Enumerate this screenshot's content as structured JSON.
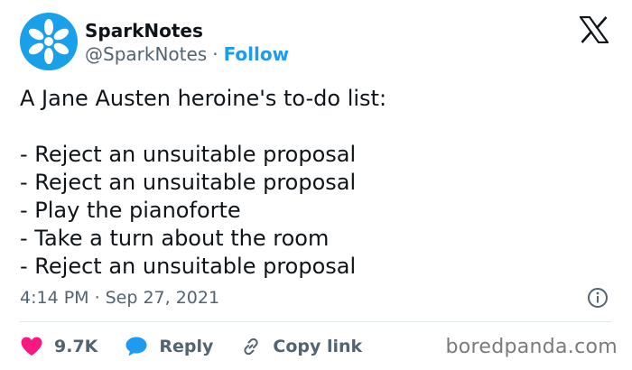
{
  "account": {
    "name": "SparkNotes",
    "handle": "@SparkNotes",
    "separator": "·",
    "follow_label": "Follow",
    "avatar_icon": "sparknotes-logo-icon",
    "brand_color": "#1aa0e8"
  },
  "platform_icon": "x-logo-icon",
  "tweet": {
    "intro": "A Jane Austen heroine's to-do list:",
    "items": [
      "- Reject an unsuitable proposal",
      "- Reject an unsuitable proposal",
      "- Play the pianoforte",
      "- Take a turn about the room",
      "- Reject an unsuitable proposal"
    ]
  },
  "meta": {
    "time": "4:14 PM",
    "separator": "·",
    "date": "Sep 27, 2021",
    "info_icon": "info-icon"
  },
  "actions": {
    "like_count": "9.7K",
    "like_icon": "heart-icon",
    "like_color": "#f91880",
    "reply_label": "Reply",
    "reply_icon": "speech-bubble-icon",
    "reply_color": "#1d9bf0",
    "copy_label": "Copy link",
    "copy_icon": "link-icon"
  },
  "watermark": "boredpanda.com"
}
